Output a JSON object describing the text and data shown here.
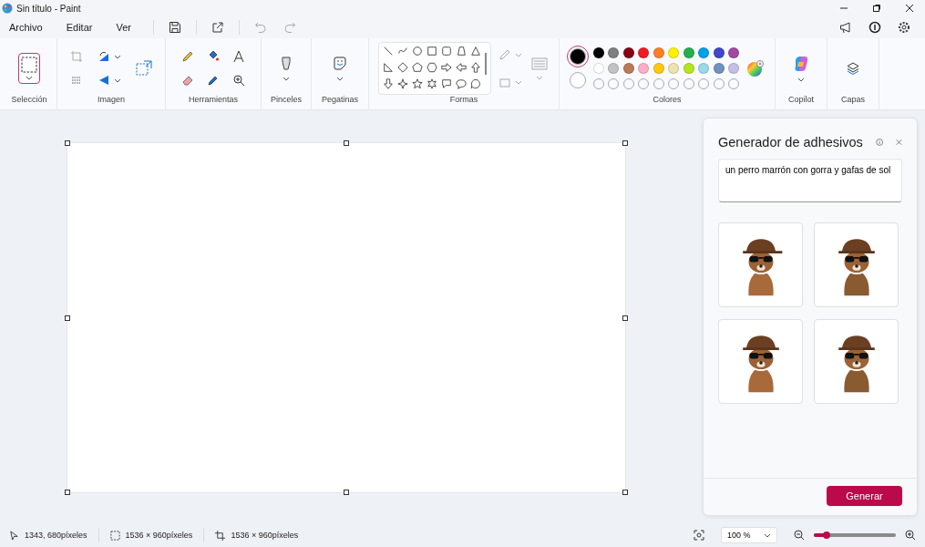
{
  "window": {
    "title": "Sin título - Paint"
  },
  "menu": [
    {
      "label": "Archivo"
    },
    {
      "label": "Editar"
    },
    {
      "label": "Ver"
    }
  ],
  "ribbon": {
    "groups": [
      {
        "label": "Selección",
        "kind": "selection"
      },
      {
        "label": "Imagen",
        "kind": "image"
      },
      {
        "label": "Herramientas",
        "kind": "tools"
      },
      {
        "label": "Pinceles",
        "kind": "brushes"
      },
      {
        "label": "Pegatinas",
        "kind": "stickers"
      },
      {
        "label": "Formas",
        "kind": "shapes"
      },
      {
        "label": "Colores",
        "kind": "colors"
      },
      {
        "label": "Copilot",
        "kind": "copilot"
      },
      {
        "label": "Capas",
        "kind": "layers"
      }
    ],
    "selection_tool": {
      "selected": true
    },
    "colors": {
      "current": [
        {
          "color": "#000000",
          "selected": true
        },
        {
          "color": "#ffffff",
          "selected": false
        }
      ],
      "palette": [
        {
          "color": "#000000"
        },
        {
          "color": "#7f7f7f"
        },
        {
          "color": "#880015"
        },
        {
          "color": "#ed1c24"
        },
        {
          "color": "#ff7f27"
        },
        {
          "color": "#fff200"
        },
        {
          "color": "#22b14c"
        },
        {
          "color": "#00a2e8"
        },
        {
          "color": "#3f48cc"
        },
        {
          "color": "#a349a4"
        },
        {
          "color": "#ffffff"
        },
        {
          "color": "#c3c3c3"
        },
        {
          "color": "#b97a57"
        },
        {
          "color": "#ffaec9"
        },
        {
          "color": "#ffc90e"
        },
        {
          "color": "#efe4b0"
        },
        {
          "color": "#b5e61d"
        },
        {
          "color": "#99d9ea"
        },
        {
          "color": "#7092be"
        },
        {
          "color": "#c8bfe7"
        }
      ]
    }
  },
  "sticker_panel": {
    "title": "Generador de adhesivos",
    "prompt": "un perro marrón con gorra y gafas de sol",
    "button": "Generar"
  },
  "status_bar": {
    "cursor": "1343, 680píxeles",
    "selection_size": "1536 × 960píxeles",
    "canvas_size": "1536 × 960píxeles",
    "zoom": "100 %",
    "zoom_slider": {
      "level": 0.15
    }
  }
}
